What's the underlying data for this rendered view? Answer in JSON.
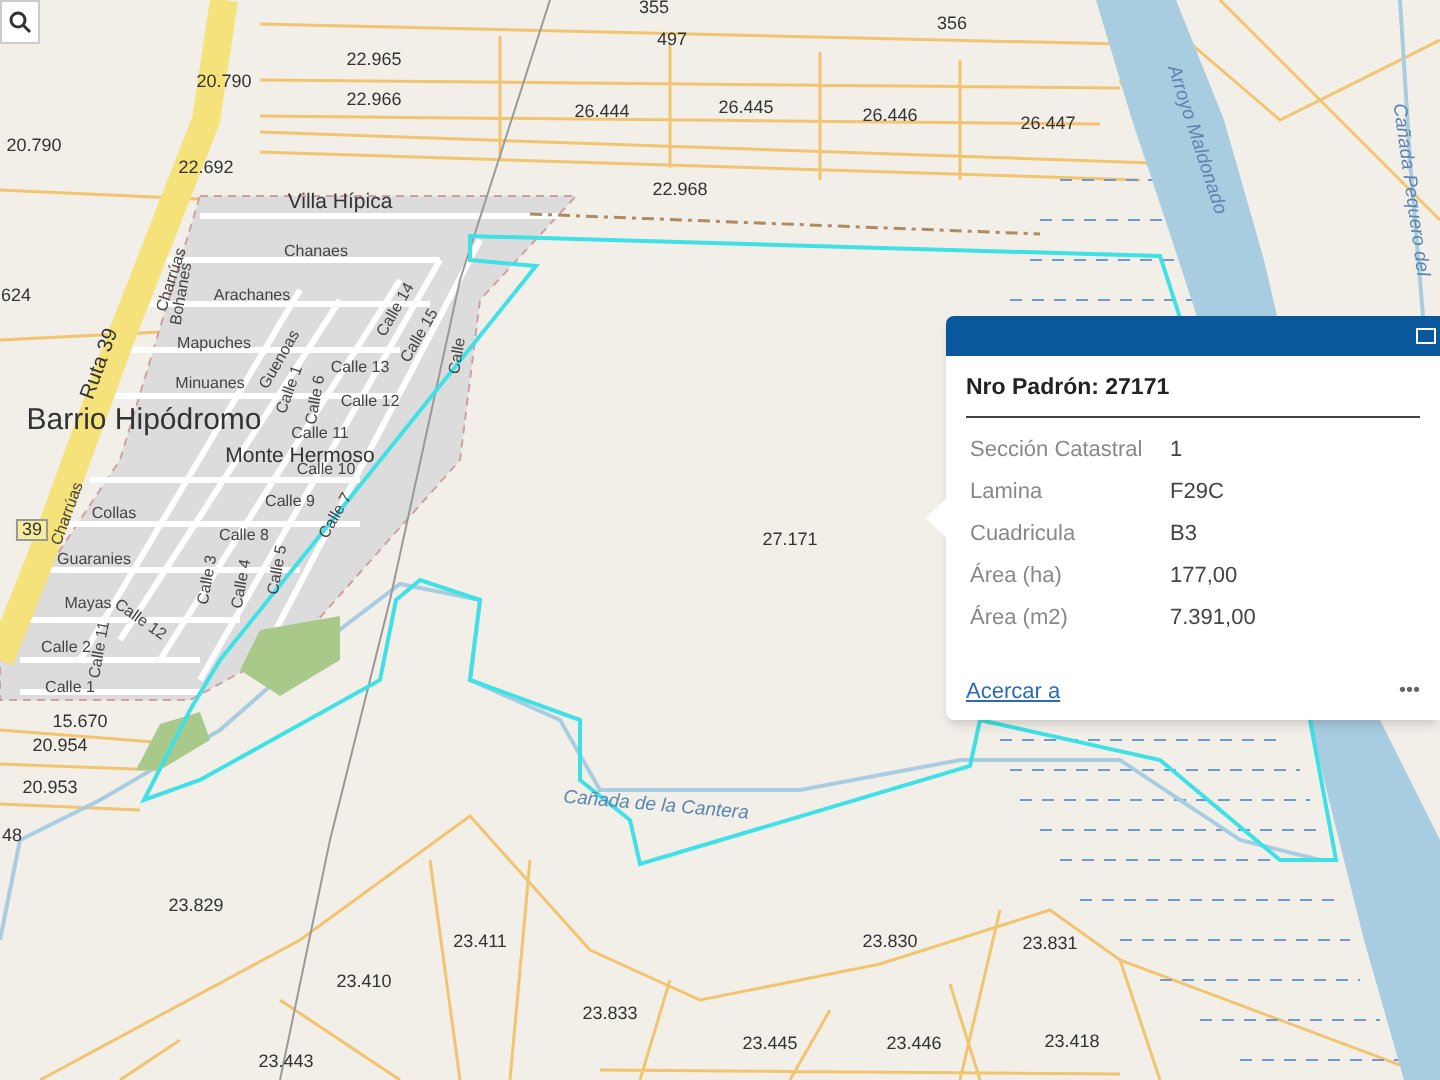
{
  "map_labels": [
    {
      "text": "355",
      "kind": "parcel"
    },
    {
      "text": "356",
      "kind": "parcel"
    },
    {
      "text": "497",
      "kind": "parcel"
    },
    {
      "text": "22.965",
      "kind": "parcel"
    },
    {
      "text": "22.966",
      "kind": "parcel"
    },
    {
      "text": "20.790",
      "kind": "parcel"
    },
    {
      "text": "20.790",
      "kind": "parcel"
    },
    {
      "text": "26.444",
      "kind": "parcel"
    },
    {
      "text": "26.445",
      "kind": "parcel"
    },
    {
      "text": "26.446",
      "kind": "parcel"
    },
    {
      "text": "26.447",
      "kind": "parcel"
    },
    {
      "text": "22.692",
      "kind": "parcel"
    },
    {
      "text": "22.968",
      "kind": "parcel"
    },
    {
      "text": "624",
      "kind": "parcel"
    },
    {
      "text": "Villa Hípica",
      "kind": "place"
    },
    {
      "text": "Chanaes",
      "kind": "street"
    },
    {
      "text": "Arachanes",
      "kind": "street"
    },
    {
      "text": "Mapuches",
      "kind": "street"
    },
    {
      "text": "Bohanes",
      "kind": "street"
    },
    {
      "text": "Charrúas",
      "kind": "street"
    },
    {
      "text": "Minuanes",
      "kind": "street"
    },
    {
      "text": "Guenoas",
      "kind": "street"
    },
    {
      "text": "Calle 14",
      "kind": "street"
    },
    {
      "text": "Calle 15",
      "kind": "street"
    },
    {
      "text": "Calle",
      "kind": "street"
    },
    {
      "text": "Calle 13",
      "kind": "street"
    },
    {
      "text": "Calle 1",
      "kind": "street"
    },
    {
      "text": "Calle 6",
      "kind": "street"
    },
    {
      "text": "Calle 12",
      "kind": "street"
    },
    {
      "text": "Barrio Hipódromo",
      "kind": "district"
    },
    {
      "text": "Calle 11",
      "kind": "street"
    },
    {
      "text": "Monte Hermoso",
      "kind": "place"
    },
    {
      "text": "Calle 10",
      "kind": "street"
    },
    {
      "text": "Calle 9",
      "kind": "street"
    },
    {
      "text": "Calle 7",
      "kind": "street"
    },
    {
      "text": "Collas",
      "kind": "street"
    },
    {
      "text": "Calle 8",
      "kind": "street"
    },
    {
      "text": "Guaranies",
      "kind": "street"
    },
    {
      "text": "Calle 3",
      "kind": "street"
    },
    {
      "text": "Calle 4",
      "kind": "street"
    },
    {
      "text": "Calle 5",
      "kind": "street"
    },
    {
      "text": "Mayas",
      "kind": "street"
    },
    {
      "text": "Calle 12",
      "kind": "street"
    },
    {
      "text": "Calle 11",
      "kind": "street"
    },
    {
      "text": "Calle 2",
      "kind": "street"
    },
    {
      "text": "Calle 1",
      "kind": "street"
    },
    {
      "text": "Ruta 39",
      "kind": "road"
    },
    {
      "text": "39",
      "kind": "shield"
    },
    {
      "text": "Charrúas",
      "kind": "street"
    },
    {
      "text": "15.670",
      "kind": "parcel"
    },
    {
      "text": "20.954",
      "kind": "parcel"
    },
    {
      "text": "20.953",
      "kind": "parcel"
    },
    {
      "text": "48",
      "kind": "parcel"
    },
    {
      "text": "27.171",
      "kind": "parcel"
    },
    {
      "text": "Arroyo Maldonado",
      "kind": "water"
    },
    {
      "text": "Cañada Pequero del",
      "kind": "water"
    },
    {
      "text": "Cañada de la Cantera",
      "kind": "water"
    },
    {
      "text": "23.829",
      "kind": "parcel"
    },
    {
      "text": "23.411",
      "kind": "parcel"
    },
    {
      "text": "23.410",
      "kind": "parcel"
    },
    {
      "text": "23.833",
      "kind": "parcel"
    },
    {
      "text": "23.830",
      "kind": "parcel"
    },
    {
      "text": "23.831",
      "kind": "parcel"
    },
    {
      "text": "23.443",
      "kind": "parcel"
    },
    {
      "text": "23.445",
      "kind": "parcel"
    },
    {
      "text": "23.446",
      "kind": "parcel"
    },
    {
      "text": "23.418",
      "kind": "parcel"
    }
  ],
  "popup": {
    "title": "Nro Padrón: 27171",
    "fields": [
      {
        "label": "Sección Catastral",
        "value": "1"
      },
      {
        "label": "Lamina",
        "value": "F29C"
      },
      {
        "label": "Cuadricula",
        "value": "B3"
      },
      {
        "label": "Área (ha)",
        "value": "177,00"
      },
      {
        "label": "Área (m2)",
        "value": "7.391,00"
      }
    ],
    "link": "Acercar a",
    "menu": "•••"
  }
}
